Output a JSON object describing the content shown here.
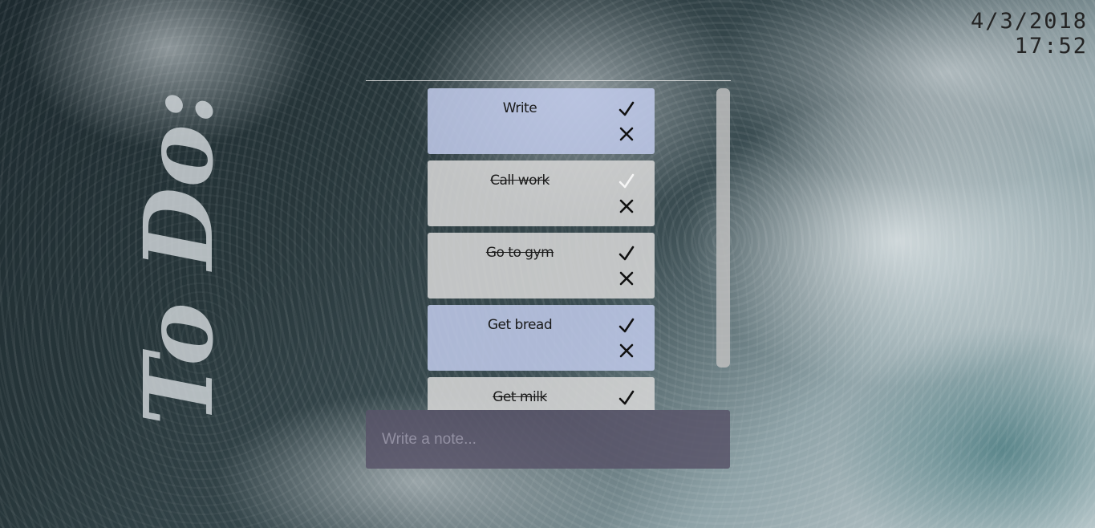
{
  "app": {
    "logo_text": "To Do:"
  },
  "datetime": {
    "date": "4/3/2018",
    "time": "17:52"
  },
  "todos": [
    {
      "text": "Write",
      "done": false
    },
    {
      "text": "Call work",
      "done": true
    },
    {
      "text": "Go to gym",
      "done": true
    },
    {
      "text": "Get bread",
      "done": false
    },
    {
      "text": "Get milk",
      "done": true
    }
  ],
  "input": {
    "placeholder": "Write a note..."
  },
  "icons": {
    "check": "check-icon",
    "delete": "close-icon"
  },
  "colors": {
    "active_card": "#bec8e8",
    "done_card": "#d6d6d6",
    "input_bg": "#585468"
  }
}
